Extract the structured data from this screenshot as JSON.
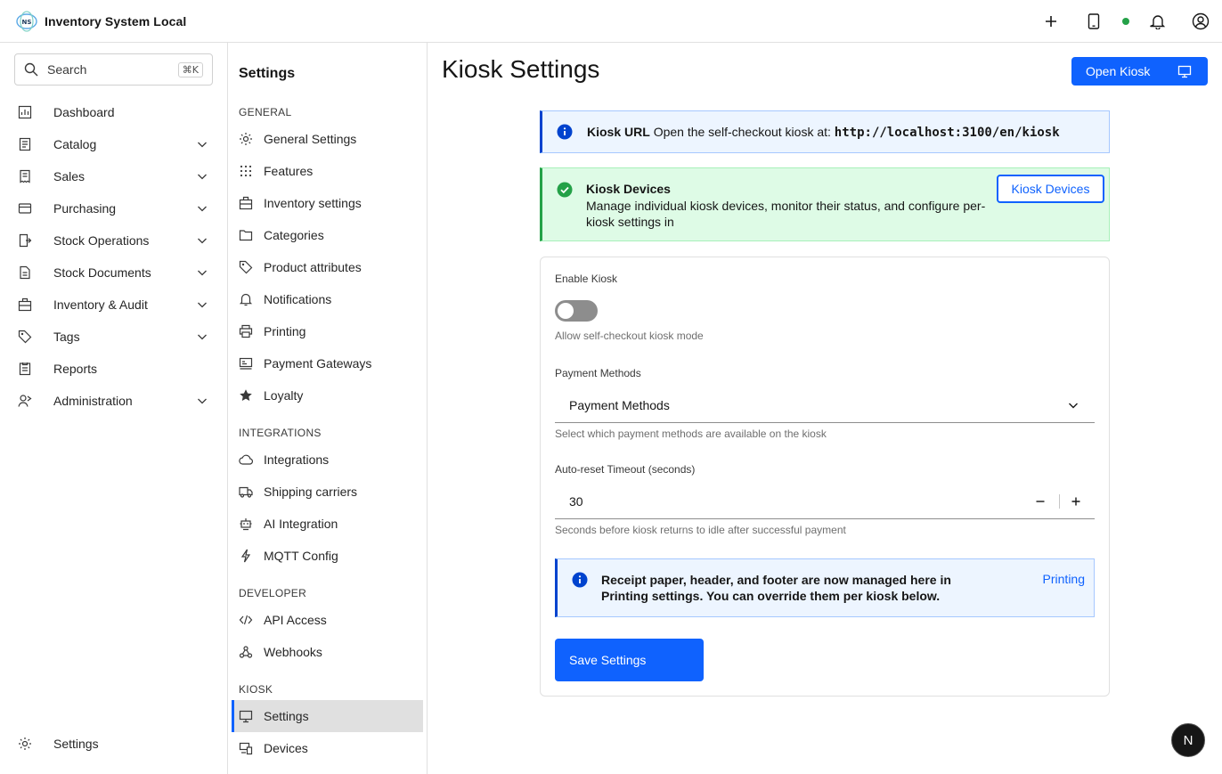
{
  "header": {
    "app_name": "Inventory System Local",
    "logo_text": "NS",
    "actions": [
      {
        "icon": "plus-icon"
      },
      {
        "icon": "tablet-icon"
      },
      {
        "icon": "bell-icon"
      },
      {
        "icon": "user-avatar-icon"
      }
    ],
    "status_color": "#24a148"
  },
  "search": {
    "placeholder": "Search",
    "shortcut": "⌘K"
  },
  "sidebar": {
    "items": [
      {
        "label": "Dashboard",
        "icon": "dashboard-icon",
        "expandable": false
      },
      {
        "label": "Catalog",
        "icon": "catalog-icon",
        "expandable": true
      },
      {
        "label": "Sales",
        "icon": "receipt-icon",
        "expandable": true
      },
      {
        "label": "Purchasing",
        "icon": "card-icon",
        "expandable": true
      },
      {
        "label": "Stock Operations",
        "icon": "stock-ops-icon",
        "expandable": true
      },
      {
        "label": "Stock Documents",
        "icon": "document-icon",
        "expandable": true
      },
      {
        "label": "Inventory & Audit",
        "icon": "audit-icon",
        "expandable": true
      },
      {
        "label": "Tags",
        "icon": "tag-icon",
        "expandable": true
      },
      {
        "label": "Reports",
        "icon": "report-icon",
        "expandable": false
      },
      {
        "label": "Administration",
        "icon": "admin-icon",
        "expandable": true
      }
    ],
    "footer": {
      "label": "Settings",
      "icon": "gear-icon"
    }
  },
  "settings_nav": {
    "title": "Settings",
    "sections": {
      "general": "GENERAL",
      "integrations": "INTEGRATIONS",
      "developer": "DEVELOPER",
      "kiosk": "KIOSK"
    },
    "general": [
      {
        "label": "General Settings",
        "icon": "gear-icon"
      },
      {
        "label": "Features",
        "icon": "grid-icon"
      },
      {
        "label": "Inventory settings",
        "icon": "inventory-icon"
      },
      {
        "label": "Categories",
        "icon": "folder-icon"
      },
      {
        "label": "Product attributes",
        "icon": "tag-icon"
      },
      {
        "label": "Notifications",
        "icon": "bell-icon"
      },
      {
        "label": "Printing",
        "icon": "printer-icon"
      },
      {
        "label": "Payment Gateways",
        "icon": "payment-icon"
      },
      {
        "label": "Loyalty",
        "icon": "star-icon"
      }
    ],
    "integrations": [
      {
        "label": "Integrations",
        "icon": "cloud-icon"
      },
      {
        "label": "Shipping carriers",
        "icon": "truck-icon"
      },
      {
        "label": "AI Integration",
        "icon": "robot-icon"
      },
      {
        "label": "MQTT Config",
        "icon": "lightning-icon"
      }
    ],
    "developer": [
      {
        "label": "API Access",
        "icon": "code-icon"
      },
      {
        "label": "Webhooks",
        "icon": "webhook-icon"
      }
    ],
    "kiosk": [
      {
        "label": "Settings",
        "icon": "monitor-icon",
        "active": true
      },
      {
        "label": "Devices",
        "icon": "devices-icon",
        "active": false
      }
    ]
  },
  "main": {
    "title": "Kiosk Settings",
    "open_kiosk_label": "Open Kiosk",
    "kiosk_url_note": {
      "title": "Kiosk URL",
      "text": "Open the self-checkout kiosk at:",
      "url": "http://localhost:3100/en/kiosk"
    },
    "devices_note": {
      "title": "Kiosk Devices",
      "text": "Manage individual kiosk devices, monitor their status, and configure per-kiosk settings in",
      "button_label": "Kiosk Devices"
    },
    "form": {
      "enable_kiosk": {
        "label": "Enable Kiosk",
        "helper": "Allow self-checkout kiosk mode",
        "enabled": false
      },
      "payment_methods": {
        "label": "Payment Methods",
        "value": "Payment Methods",
        "helper": "Select which payment methods are available on the kiosk"
      },
      "auto_reset": {
        "label": "Auto-reset Timeout (seconds)",
        "value": "30",
        "helper": "Seconds before kiosk returns to idle after successful payment"
      },
      "receipt_note": {
        "text": "Receipt paper, header, and footer are now managed here in Printing settings. You can override them per kiosk below.",
        "link_label": "Printing"
      },
      "save_label": "Save Settings"
    }
  },
  "fab_label": "N",
  "colors": {
    "accent": "#0f62fe",
    "success": "#24a148",
    "info": "#0043ce"
  }
}
